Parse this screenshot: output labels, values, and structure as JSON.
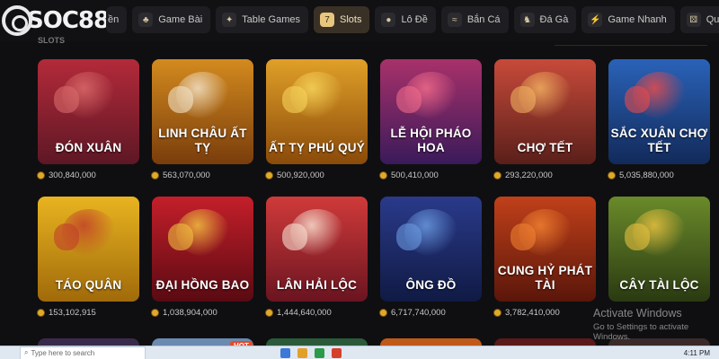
{
  "logo": {
    "text": "SOC88"
  },
  "nav": [
    {
      "label": "Sảnh Thể Thao",
      "visible": "ền",
      "icon": "ball-icon",
      "glyph": "◎"
    },
    {
      "label": "Game Bài",
      "icon": "cards-icon",
      "glyph": "♣"
    },
    {
      "label": "Table Games",
      "icon": "table-icon",
      "glyph": "✦"
    },
    {
      "label": "Slots",
      "icon": "slot-icon",
      "glyph": "7"
    },
    {
      "label": "Lô Đề",
      "icon": "lottery-ball-icon",
      "glyph": "●"
    },
    {
      "label": "Bắn Cá",
      "icon": "fish-icon",
      "glyph": "≈"
    },
    {
      "label": "Đá Gà",
      "icon": "rooster-icon",
      "glyph": "♞"
    },
    {
      "label": "Game Nhanh",
      "icon": "lightning-icon",
      "glyph": "⚡"
    },
    {
      "label": "Quay Số",
      "icon": "dice-icon",
      "glyph": "⚄"
    }
  ],
  "section": {
    "title": "SLOTS"
  },
  "games": [
    {
      "title": "ĐÓN XUÂN",
      "jackpot": "300,840,000",
      "bg": "#b32a3a",
      "bg2": "#5e1725",
      "art": "#d96a6a"
    },
    {
      "title": "LINH CHÂU ẤT TỴ",
      "jackpot": "563,070,000",
      "bg": "#d38a1e",
      "bg2": "#7a3d0c",
      "art": "#f2e2c8"
    },
    {
      "title": "ẤT TỴ PHÚ QUÝ",
      "jackpot": "500,920,000",
      "bg": "#e0a028",
      "bg2": "#8a4a0a",
      "art": "#f6d35a"
    },
    {
      "title": "LỄ HỘI PHÁO HOA",
      "jackpot": "500,410,000",
      "bg": "#a8316a",
      "bg2": "#3a1a5a",
      "art": "#f06a8a"
    },
    {
      "title": "CHỢ TẾT",
      "jackpot": "293,220,000",
      "bg": "#c74a3a",
      "bg2": "#5a1f1a",
      "art": "#f0b060"
    },
    {
      "title": "SẮC XUÂN CHỢ TẾT",
      "jackpot": "5,035,880,000",
      "bg": "#2a62b8",
      "bg2": "#122a5a",
      "art": "#e84a4a"
    },
    {
      "title": "TÁO QUÂN",
      "jackpot": "153,102,915",
      "bg": "#e8b420",
      "bg2": "#a06a0a",
      "art": "#c2402a"
    },
    {
      "title": "ĐẠI HỒNG BAO",
      "jackpot": "1,038,904,000",
      "bg": "#c41f2a",
      "bg2": "#5a0a12",
      "art": "#f2c040"
    },
    {
      "title": "LÂN HẢI LỘC",
      "jackpot": "1,444,640,000",
      "bg": "#d03a3a",
      "bg2": "#6a1420",
      "art": "#f8e0d0"
    },
    {
      "title": "ÔNG ĐỒ",
      "jackpot": "6,717,740,000",
      "bg": "#2a3a8a",
      "bg2": "#101a44",
      "art": "#6a9ae0"
    },
    {
      "title": "CUNG HỶ PHÁT TÀI",
      "jackpot": "3,782,410,000",
      "bg": "#c0401a",
      "bg2": "#5a160a",
      "art": "#f08030"
    },
    {
      "title": "CÂY TÀI LỘC",
      "jackpot": "",
      "bg": "#6a8a2a",
      "bg2": "#2a3a12",
      "art": "#e8c040"
    }
  ],
  "next_row_colors": [
    "#3a2a4a",
    "#6a8ab0",
    "#2a5a3a",
    "#c05a1a",
    "#5a1a1a",
    "#3a2a2a"
  ],
  "hot_badge": "HOT",
  "watermark": {
    "line1": "Activate Windows",
    "line2": "Go to Settings to activate Windows."
  },
  "taskbar": {
    "search_placeholder": "Type here to search",
    "time": "4:11 PM"
  },
  "colors": {
    "accent": "#e7c680",
    "background": "#0f0f11",
    "coin": "#e0a92a"
  }
}
